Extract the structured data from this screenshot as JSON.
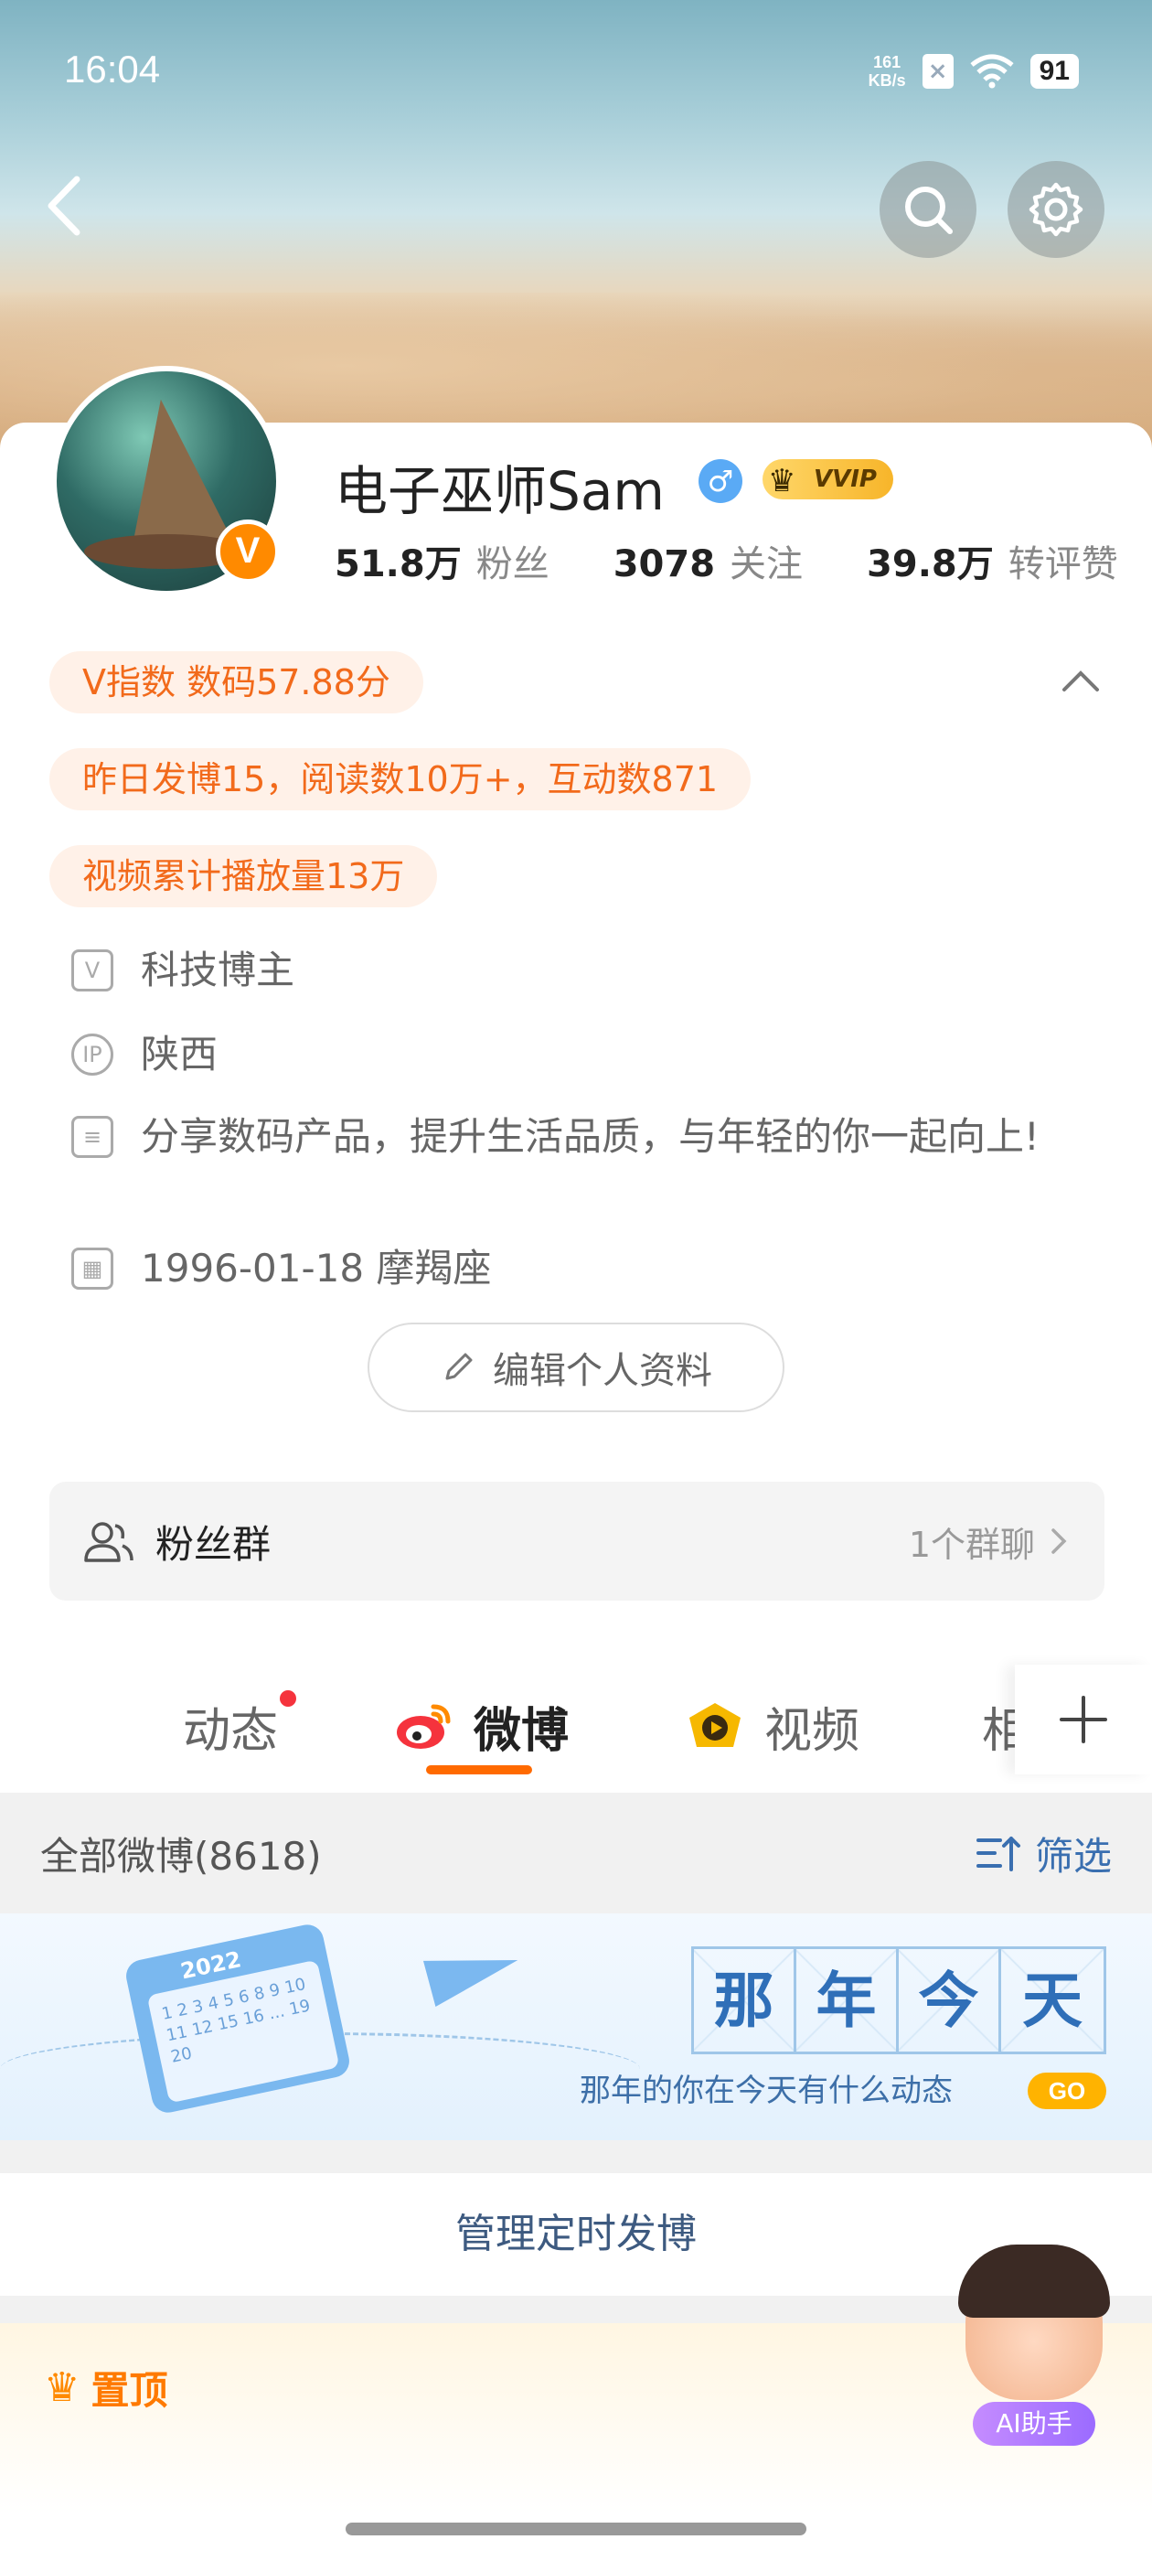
{
  "status_bar": {
    "time": "16:04",
    "net_speed_value": "161",
    "net_speed_unit": "KB/s",
    "battery": "91",
    "icons": [
      "sim-off-icon",
      "wifi-icon",
      "battery-icon"
    ]
  },
  "header": {
    "back_icon": "chevron-left-icon",
    "search_icon": "search-icon",
    "settings_icon": "gear-icon"
  },
  "profile": {
    "name": "电子巫师Sam",
    "gender_symbol": "♂",
    "vip_badge": "VVIP",
    "verified_mark": "V",
    "stats": [
      {
        "value": "51.8万",
        "label": "粉丝"
      },
      {
        "value": "3078",
        "label": "关注"
      },
      {
        "value": "39.8万",
        "label": "转评赞"
      }
    ],
    "v_index": "V指数 数码57.88分",
    "yesterday": "昨日发博15，阅读数10万+，互动数871",
    "video_plays": "视频累计播放量13万",
    "info": [
      {
        "icon": "verified-shield-icon",
        "text": "科技博主"
      },
      {
        "icon": "ip-icon",
        "text": "陕西"
      },
      {
        "icon": "document-icon",
        "text": "分享数码产品，提升生活品质，与年轻的你一起向上!"
      },
      {
        "icon": "calendar-icon",
        "text": "1996-01-18 摩羯座"
      }
    ],
    "edit_button": "编辑个人资料"
  },
  "fans_group": {
    "label": "粉丝群",
    "right_text": "1个群聊"
  },
  "tabs": [
    {
      "label": "动态",
      "active": false,
      "has_red_dot": true
    },
    {
      "label": "微博",
      "active": true
    },
    {
      "label": "视频",
      "active": false
    },
    {
      "label": "相",
      "active": false
    }
  ],
  "filter_bar": {
    "all_label": "全部微博(8618)",
    "filter_label": "筛选"
  },
  "banner": {
    "calendar_year": "2022",
    "calendar_nums": "1 2 3 4 5 6\n8 9 10 11 12\n15 16 ... 19 20",
    "title_chars": [
      "那",
      "年",
      "今",
      "天"
    ],
    "subtitle": "那年的你在今天有什么动态",
    "go": "GO"
  },
  "schedule_label": "管理定时发博",
  "pinned_label": "置顶",
  "ai_helper_label": "AI助手",
  "colors": {
    "accent_orange": "#ff6a00",
    "pill_bg": "#fff1e8",
    "pill_text": "#f26a1b",
    "link_blue": "#3a6fb0"
  }
}
